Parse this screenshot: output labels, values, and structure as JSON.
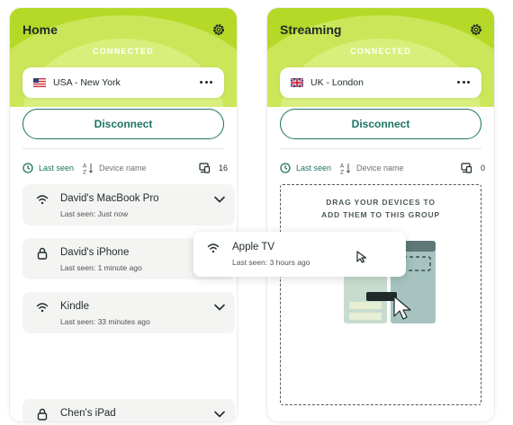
{
  "home": {
    "title": "Home",
    "status": "CONNECTED",
    "location": "USA - New York",
    "flag_icon": "us-flag-icon",
    "disconnect_label": "Disconnect",
    "sort_last_seen": "Last seen",
    "sort_device_name": "Device name",
    "device_count": "16",
    "devices": [
      {
        "name": "David's MacBook Pro",
        "seen": "Last seen: Just now",
        "icon": "wifi-icon"
      },
      {
        "name": "David's iPhone",
        "seen": "Last seen: 1 minute ago",
        "icon": "lock-icon"
      },
      {
        "name": "Kindle",
        "seen": "Last seen: 33 minutes ago",
        "icon": "wifi-icon"
      },
      {
        "name": "Chen's iPad",
        "seen": "",
        "icon": "lock-icon"
      }
    ]
  },
  "streaming": {
    "title": "Streaming",
    "status": "CONNECTED",
    "location": "UK - London",
    "flag_icon": "uk-flag-icon",
    "disconnect_label": "Disconnect",
    "sort_last_seen": "Last seen",
    "sort_device_name": "Device name",
    "device_count": "0",
    "drop_line1": "DRAG YOUR DEVICES TO",
    "drop_line2": "ADD THEM TO THIS GROUP"
  },
  "dragging": {
    "name": "Apple TV",
    "seen": "Last seen: 3 hours ago",
    "icon": "wifi-icon"
  },
  "colors": {
    "accent": "#1d7364",
    "header_green": "#b5d926",
    "card_bg": "#f4f5f3"
  }
}
